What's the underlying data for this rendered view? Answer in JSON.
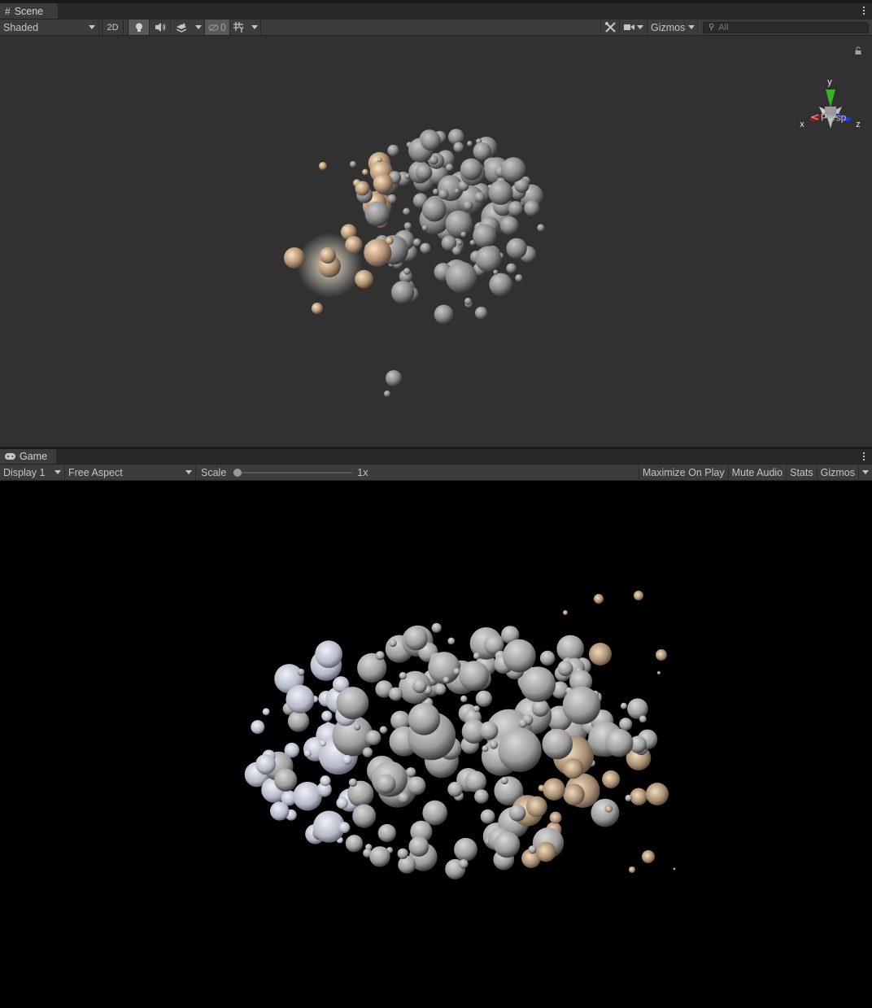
{
  "scene": {
    "tab_label": "Scene",
    "tab_icon": "grid-icon",
    "shading_mode": "Shaded",
    "toggle_2d": "2D",
    "lighting_on": true,
    "hidden_objects_count": "0",
    "gizmos_label": "Gizmos",
    "search_placeholder": "All",
    "axis_labels": {
      "x": "x",
      "y": "y",
      "z": "z"
    },
    "projection_label": "Persp",
    "colors": {
      "background": "#313131",
      "axis_x": "#a31515",
      "axis_y": "#39b226",
      "axis_z": "#1b3fd0"
    }
  },
  "game": {
    "tab_label": "Game",
    "tab_icon": "gamepad-icon",
    "display": "Display 1",
    "aspect": "Free Aspect",
    "scale_label": "Scale",
    "scale_value": "1x",
    "scale_fraction": 0,
    "maximize_on_play": "Maximize On Play",
    "mute_audio": "Mute Audio",
    "stats": "Stats",
    "gizmos_label": "Gizmos",
    "colors": {
      "background": "#000000"
    }
  }
}
